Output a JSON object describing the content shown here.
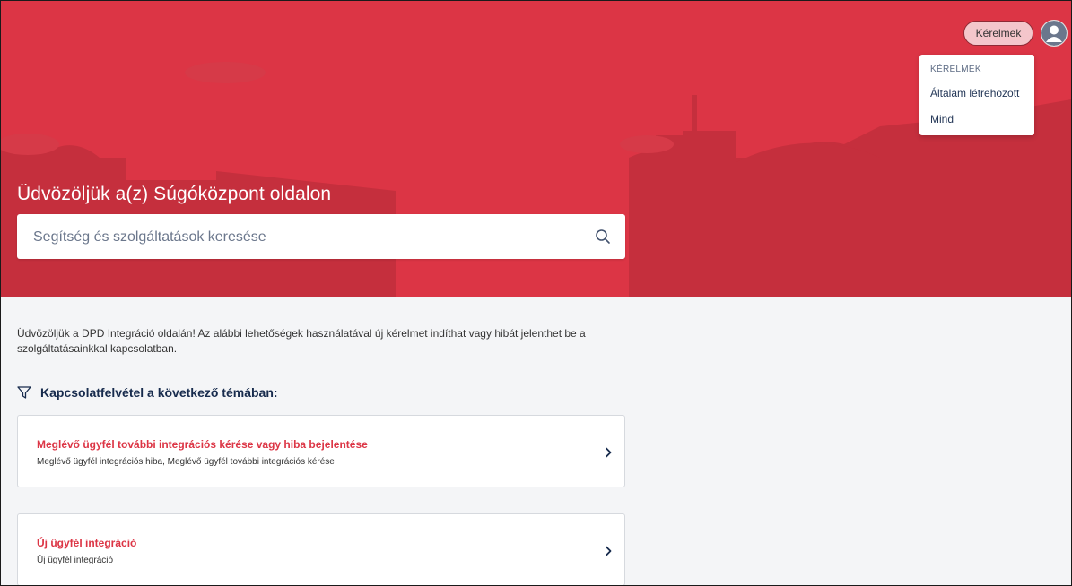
{
  "header": {
    "requests_button": "Kérelmek",
    "avatar_icon": "user-avatar-icon"
  },
  "dropdown": {
    "header": "KÉRELMEK",
    "items": [
      "Általam létrehozott",
      "Mind"
    ]
  },
  "hero": {
    "title": "Üdvözöljük a(z) Súgóközpont oldalon",
    "background_color": "#dc3545",
    "search_placeholder": "Segítség és szolgáltatások keresése",
    "search_icon": "search-icon"
  },
  "intro": {
    "text": "Üdvözöljük a DPD Integráció oldalán! Az alábbi lehetőségek használatával új kérelmet indíthat vagy hibát jelenthet be a szolgáltatásainkkal kapcsolatban."
  },
  "topics": {
    "heading": "Kapcsolatfelvétel a következő témában:",
    "icon": "filter-icon",
    "cards": [
      {
        "title": "Meglévő ügyfél további integrációs kérése vagy hiba bejelentése",
        "description": "Meglévő ügyfél integrációs hiba, Meglévő ügyfél további integrációs kérése"
      },
      {
        "title": "Új ügyfél integráció",
        "description": "Új ügyfél integráció"
      }
    ]
  }
}
